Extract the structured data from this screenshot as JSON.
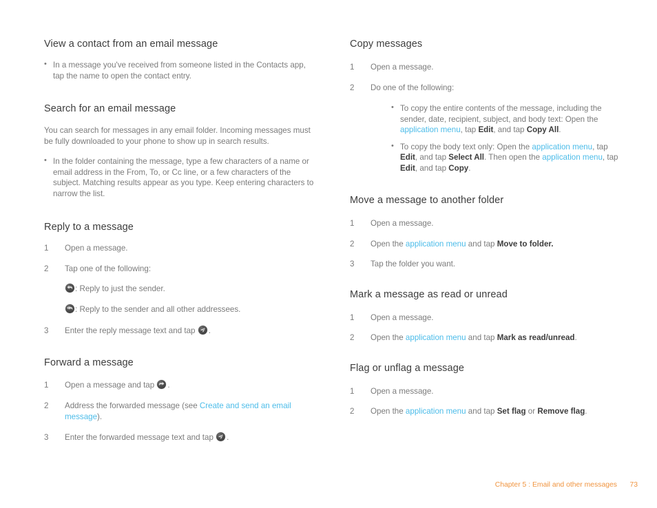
{
  "footer": {
    "chapter": "Chapter 5  :  Email and other messages",
    "page_number": "73"
  },
  "links": {
    "application_menu": "application menu",
    "create_send_email_1": "Create and send an email",
    "create_send_email_2": "message"
  },
  "icons": {
    "reply": "reply-icon",
    "reply_all": "reply-all-icon",
    "send": "send-icon",
    "forward": "forward-icon"
  },
  "left_column": {
    "sections": [
      {
        "title": "View a contact from an email message",
        "bullets": [
          "In a message you've received from someone listed in the Contacts app, tap the name to open the contact entry."
        ]
      },
      {
        "title": "Search for an email message",
        "intro": "You can search for messages in any email folder. Incoming messages must be fully downloaded to your phone to show up in search results.",
        "bullets": [
          "In the folder containing the message, type a few characters of a name or email address in the From, To, or Cc line, or a few characters of the subject. Matching results appear as you type. Keep entering characters to narrow the list."
        ]
      },
      {
        "title": "Reply to a message",
        "steps": [
          {
            "num": "1",
            "text": "Open a message."
          },
          {
            "num": "2",
            "text": "Tap one of the following:"
          },
          {
            "num": "3",
            "text_before": "Enter the reply message text and tap ",
            "text_after": "."
          }
        ],
        "icon_lines": [
          {
            "text": ": Reply to just the sender."
          },
          {
            "text": ": Reply to the sender and all other addressees."
          }
        ]
      },
      {
        "title": "Forward a message",
        "steps": [
          {
            "num": "1",
            "text_before": "Open a message and tap ",
            "text_after": "."
          },
          {
            "num": "2",
            "text_before": "Address the forwarded message (see ",
            "text_after": ")."
          },
          {
            "num": "3",
            "text_before": "Enter the forwarded message text and tap ",
            "text_after": "."
          }
        ]
      }
    ]
  },
  "right_column": {
    "sections": [
      {
        "title": "Copy messages",
        "steps": [
          {
            "num": "1",
            "text": "Open a message."
          },
          {
            "num": "2",
            "text": "Do one of the following:"
          }
        ],
        "sub_bullets": [
          {
            "p1": "To copy the entire contents of the message, including the sender, date, recipient, subject, and body text: Open the ",
            "p2": ", tap ",
            "b1": "Edit",
            "p3": ", and tap ",
            "b2": "Copy All",
            "p4": "."
          },
          {
            "p1": "To copy the body text only: Open the ",
            "p2": ", tap ",
            "b1": "Edit",
            "p3": ", and tap ",
            "b2": "Select All",
            "p4": ". Then open the ",
            "p5": ", tap ",
            "b3": "Edit",
            "p6": ", and tap ",
            "b4": "Copy",
            "p7": "."
          }
        ]
      },
      {
        "title": "Move a message to another folder",
        "steps": [
          {
            "num": "1",
            "text": "Open a message."
          },
          {
            "num": "2",
            "p1": "Open the ",
            "p2": " and tap ",
            "b1": "Move to folder.",
            "p3": ""
          },
          {
            "num": "3",
            "text": "Tap the folder you want."
          }
        ]
      },
      {
        "title": "Mark a message as read or unread",
        "steps": [
          {
            "num": "1",
            "text": "Open a message."
          },
          {
            "num": "2",
            "p1": "Open the ",
            "p2": " and tap ",
            "b1": "Mark as read/unread",
            "p3": "."
          }
        ]
      },
      {
        "title": "Flag or unflag a message",
        "steps": [
          {
            "num": "1",
            "text": "Open a message."
          },
          {
            "num": "2",
            "p1": "Open the ",
            "p2": " and tap ",
            "b1": "Set flag",
            "p3": " or ",
            "b2": "Remove flag",
            "p4": "."
          }
        ]
      }
    ]
  }
}
